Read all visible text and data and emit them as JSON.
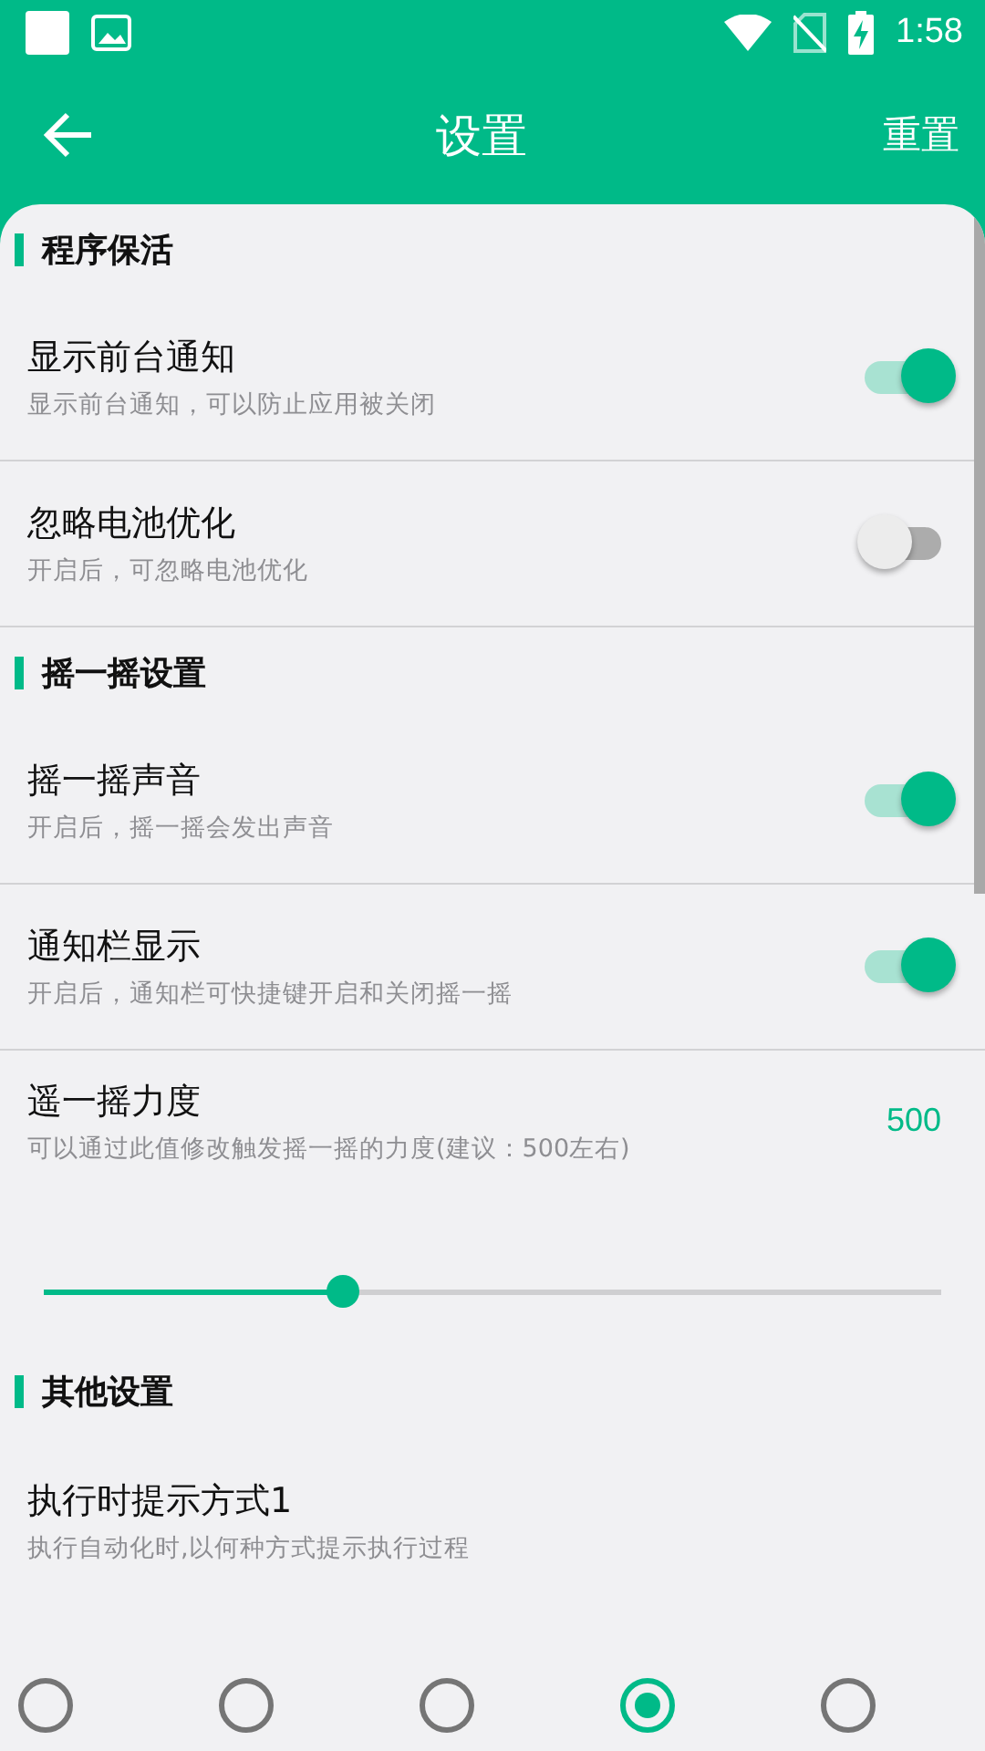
{
  "status_bar": {
    "time": "1:58"
  },
  "header": {
    "title": "设置",
    "action": "重置"
  },
  "sections": [
    {
      "title": "程序保活",
      "items": [
        {
          "kind": "toggle",
          "title": "显示前台通知",
          "subtitle": "显示前台通知，可以防止应用被关闭",
          "on": true
        },
        {
          "kind": "toggle",
          "title": "忽略电池优化",
          "subtitle": "开启后，可忽略电池优化",
          "on": false
        }
      ]
    },
    {
      "title": "摇一摇设置",
      "items": [
        {
          "kind": "toggle",
          "title": "摇一摇声音",
          "subtitle": "开启后，摇一摇会发出声音",
          "on": true
        },
        {
          "kind": "toggle",
          "title": "通知栏显示",
          "subtitle": "开启后，通知栏可快捷键开启和关闭摇一摇",
          "on": true
        },
        {
          "kind": "slider",
          "title": "遥一摇力度",
          "subtitle": "可以通过此值修改触发摇一摇的力度(建议：500左右)",
          "value": "500",
          "level": 0.333
        }
      ]
    },
    {
      "title": "其他设置",
      "items": [
        {
          "kind": "radio",
          "title": "执行时提示方式1",
          "subtitle": "执行自动化时,以何种方式提示执行过程",
          "options": [
            {
              "selected": false
            },
            {
              "selected": false
            },
            {
              "selected": false
            },
            {
              "selected": true
            },
            {
              "selected": false
            }
          ]
        }
      ]
    }
  ]
}
